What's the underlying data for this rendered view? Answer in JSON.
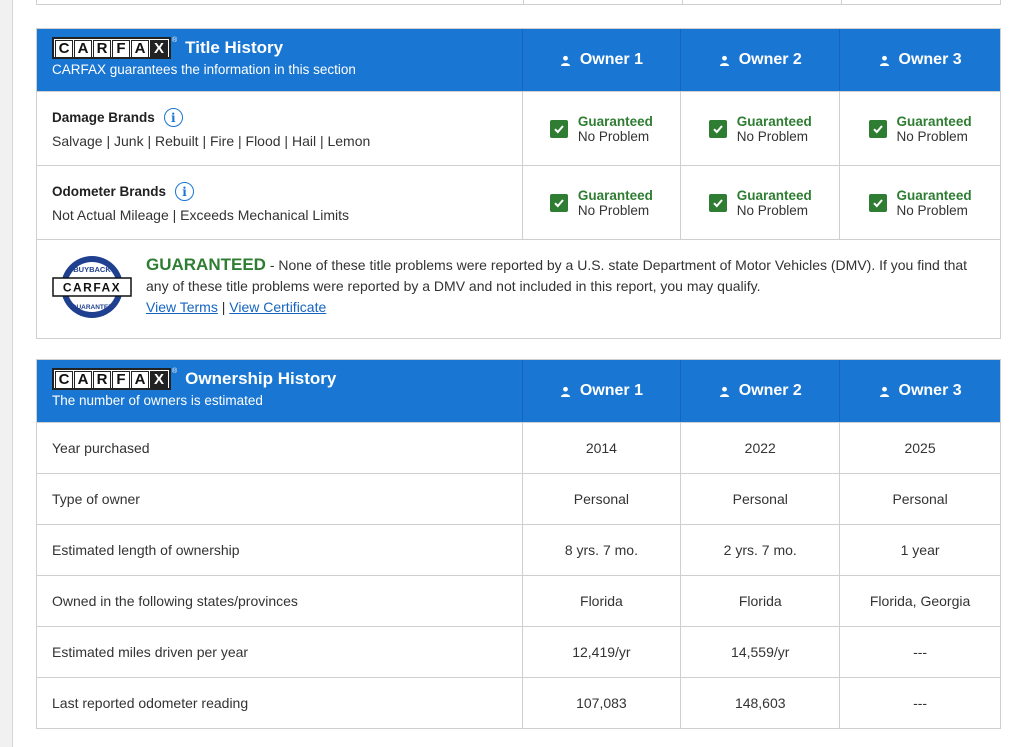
{
  "title_history": {
    "logo_letters": [
      "C",
      "A",
      "R",
      "F",
      "A",
      "X"
    ],
    "title": "Title History",
    "subtitle": "CARFAX guarantees the information in this section",
    "owners": [
      "Owner 1",
      "Owner 2",
      "Owner 3"
    ],
    "rows": [
      {
        "name": "Damage Brands",
        "list": "Salvage | Junk | Rebuilt | Fire | Flood | Hail | Lemon",
        "cells": [
          {
            "status": "Guaranteed",
            "detail": "No Problem"
          },
          {
            "status": "Guaranteed",
            "detail": "No Problem"
          },
          {
            "status": "Guaranteed",
            "detail": "No Problem"
          }
        ]
      },
      {
        "name": "Odometer Brands",
        "list": "Not Actual Mileage | Exceeds Mechanical Limits",
        "cells": [
          {
            "status": "Guaranteed",
            "detail": "No Problem"
          },
          {
            "status": "Guaranteed",
            "detail": "No Problem"
          },
          {
            "status": "Guaranteed",
            "detail": "No Problem"
          }
        ]
      }
    ],
    "guarantee": {
      "seal_top": "BUYBACK",
      "seal_mid": "CARFAX",
      "seal_bottom": "GUARANTEE",
      "heading": "GUARANTEED",
      "text": " - None of these title problems were reported by a U.S. state Department of Motor Vehicles (DMV). If you find that any of these title problems were reported by a DMV and not included in this report, you may qualify.",
      "view_terms": "View Terms",
      "separator": " | ",
      "view_certificate": "View Certificate"
    }
  },
  "ownership_history": {
    "title": "Ownership History",
    "subtitle": "The number of owners is estimated",
    "owners": [
      "Owner 1",
      "Owner 2",
      "Owner 3"
    ],
    "rows": [
      {
        "label": "Year purchased",
        "values": [
          "2014",
          "2022",
          "2025"
        ]
      },
      {
        "label": "Type of owner",
        "values": [
          "Personal",
          "Personal",
          "Personal"
        ]
      },
      {
        "label": "Estimated length of ownership",
        "values": [
          "8 yrs. 7 mo.",
          "2 yrs. 7 mo.",
          "1 year"
        ]
      },
      {
        "label": "Owned in the following states/provinces",
        "values": [
          "Florida",
          "Florida",
          "Florida, Georgia"
        ]
      },
      {
        "label": "Estimated miles driven per year",
        "values": [
          "12,419/yr",
          "14,559/yr",
          "---"
        ]
      },
      {
        "label": "Last reported odometer reading",
        "values": [
          "107,083",
          "148,603",
          "---"
        ]
      }
    ]
  },
  "colors": {
    "header_blue": "#1976d2",
    "guaranteed_green": "#2e7d32",
    "link_blue": "#1565c0"
  },
  "icons": {
    "owner": "person-icon",
    "info": "info-icon",
    "check": "checkbox-checked-icon",
    "seal": "buyback-guarantee-seal-icon"
  }
}
